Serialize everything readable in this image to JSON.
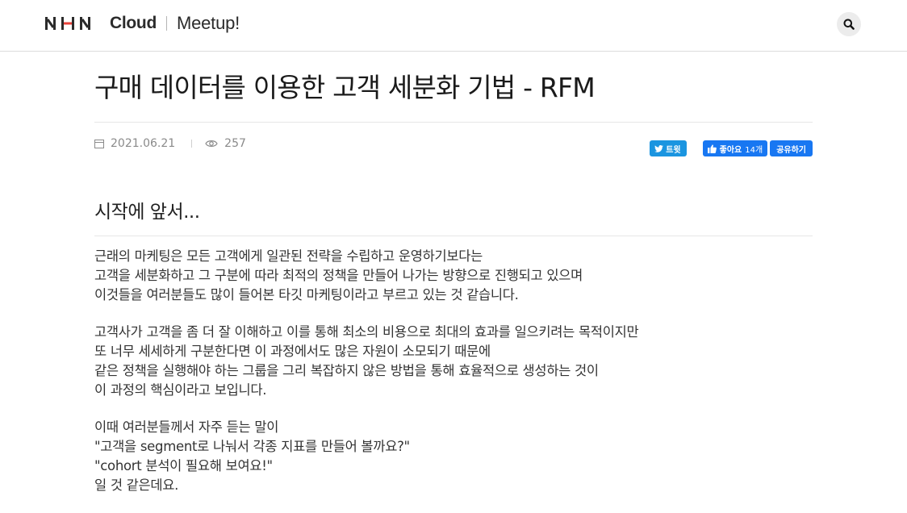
{
  "header": {
    "logo_text": "Cloud",
    "logo_sub": "Meetup!",
    "search_icon": "search-icon"
  },
  "article": {
    "title": "구매 데이터를 이용한 고객 세분화 기법 - RFM",
    "date": "2021.06.21",
    "views": "257",
    "share": {
      "tweet_label": "트윗",
      "like_label": "좋아요",
      "like_count": "14개",
      "share_label": "공유하기"
    },
    "section_title": "시작에 앞서...",
    "paragraphs": [
      {
        "lines": [
          "근래의 마케팅은 모든 고객에게 일관된 전략을 수립하고 운영하기보다는",
          "고객을 세분화하고 그 구분에 따라 최적의 정책을 만들어 나가는 방향으로 진행되고 있으며",
          "이것들을 여러분들도 많이 들어본 타깃 마케팅이라고 부르고 있는 것 같습니다."
        ]
      },
      {
        "lines": [
          "고객사가 고객을 좀 더 잘 이해하고 이를 통해 최소의 비용으로 최대의 효과를 일으키려는 목적이지만",
          "또 너무 세세하게 구분한다면 이 과정에서도 많은 자원이 소모되기 때문에",
          "같은 정책을 실행해야 하는 그룹을 그리 복잡하지 않은 방법을 통해 효율적으로 생성하는 것이",
          "이 과정의 핵심이라고 보입니다."
        ]
      },
      {
        "lines": [
          "이때 여러분들께서 자주 듣는 말이",
          "\"고객을 segment로 나눠서 각종 지표를 만들어 볼까요?\"",
          "\"cohort 분석이 필요해 보여요!\"",
          "일 것 같은데요."
        ]
      }
    ]
  },
  "colors": {
    "twitter": "#1b95e0",
    "facebook": "#1877f2",
    "logo_accent": "#e8423a"
  }
}
